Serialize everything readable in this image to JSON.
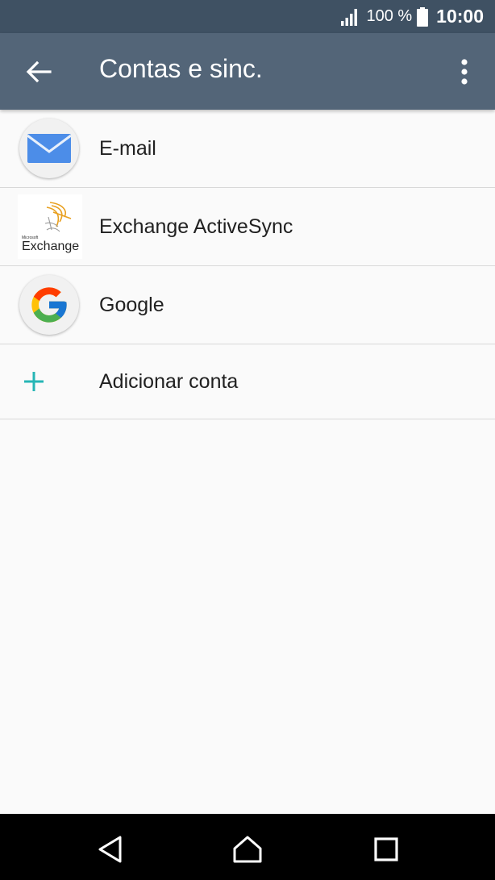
{
  "status_bar": {
    "battery_percent": "100 %",
    "time": "10:00"
  },
  "app_bar": {
    "title": "Contas e sinc."
  },
  "accounts": [
    {
      "label": "E-mail",
      "icon": "email-envelope-icon"
    },
    {
      "label": "Exchange ActiveSync",
      "icon": "microsoft-exchange-logo",
      "logo_text_small": "Microsoft",
      "logo_text": "Exchange"
    },
    {
      "label": "Google",
      "icon": "google-g-icon"
    }
  ],
  "add_account": {
    "label": "Adicionar conta",
    "icon": "plus-icon"
  },
  "colors": {
    "status_bar": "#3f5163",
    "app_bar": "#536578",
    "accent": "#26b5b5",
    "background": "#fafafa"
  }
}
